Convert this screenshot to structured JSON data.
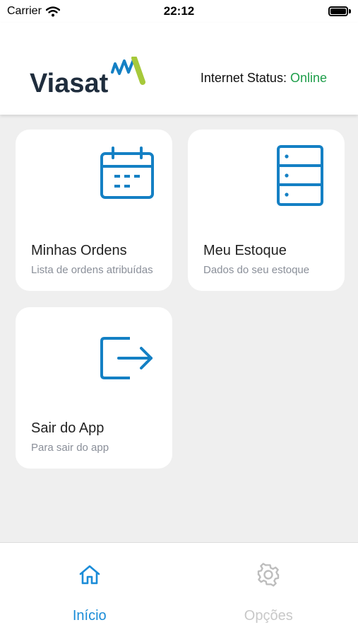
{
  "status_bar": {
    "carrier": "Carrier",
    "time": "22:12"
  },
  "header": {
    "logo_text": "Viasat",
    "status_label": "Internet Status:",
    "status_value": "Online"
  },
  "cards": [
    {
      "title": "Minhas Ordens",
      "subtitle": "Lista de ordens atribuídas",
      "icon": "calendar-icon"
    },
    {
      "title": "Meu Estoque",
      "subtitle": "Dados do seu estoque",
      "icon": "server-stack-icon"
    },
    {
      "title": "Sair do App",
      "subtitle": "Para sair do app",
      "icon": "logout-icon"
    }
  ],
  "tabs": [
    {
      "label": "Início",
      "icon": "home-icon",
      "active": true
    },
    {
      "label": "Opções",
      "icon": "gear-icon",
      "active": false
    }
  ],
  "colors": {
    "accent": "#1a8cd8",
    "icon_blue": "#1480c4",
    "online_green": "#1e9e4a",
    "logo_navy": "#1f2d3d",
    "logo_green": "#a6c93a",
    "background": "#efefef"
  }
}
